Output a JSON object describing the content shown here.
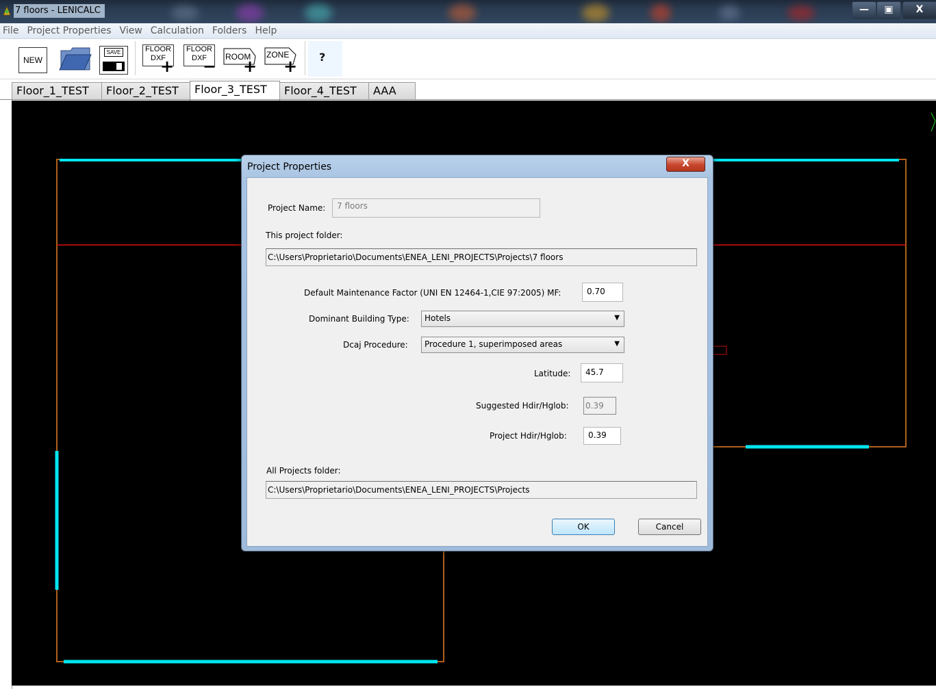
{
  "window": {
    "title": "7 floors - LENICALC"
  },
  "menu": [
    "File",
    "Project Properties",
    "View",
    "Calculation",
    "Folders",
    "Help"
  ],
  "toolbar": {
    "new_label": "NEW",
    "save_label": "SAVE",
    "floor_label_top": "FLOOR",
    "floor_label_bottom": "DXF",
    "room_label": "ROOM",
    "zone_label": "ZONE",
    "plus": "+",
    "minus": "−",
    "help_glyph": "?"
  },
  "tabs": [
    "Floor_1_TEST",
    "Floor_2_TEST",
    "Floor_3_TEST",
    "Floor_4_TEST",
    "AAA"
  ],
  "active_tab": "Floor_3_TEST",
  "dialog": {
    "title": "Project Properties",
    "close_glyph": "X",
    "project_name_label": "Project Name:",
    "project_name_value": "7 floors",
    "this_folder_label": "This project folder:",
    "this_folder_value": "C:\\Users\\Proprietario\\Documents\\ENEA_LENI_PROJECTS\\Projects\\7 floors",
    "mf_label": "Default Maintenance Factor (UNI EN 12464-1,CIE 97:2005) MF:",
    "mf_value": "0.70",
    "building_type_label": "Dominant Building Type:",
    "building_type_value": "Hotels",
    "dcaj_label": "Dcaj Procedure:",
    "dcaj_value": "Procedure 1, superimposed areas",
    "latitude_label": "Latitude:",
    "latitude_value": "45.7",
    "suggested_label": "Suggested Hdir/Hglob:",
    "suggested_value": "0.39",
    "project_ratio_label": "Project Hdir/Hglob:",
    "project_ratio_value": "0.39",
    "all_folder_label": "All Projects folder:",
    "all_folder_value": "C:\\Users\\Proprietario\\Documents\\ENEA_LENI_PROJECTS\\Projects",
    "ok_label": "OK",
    "cancel_label": "Cancel"
  },
  "colors": {
    "canvas_bg": "#000000",
    "wall": "#b0601c",
    "window": "#00e5f0",
    "zone_line": "#e01010"
  }
}
